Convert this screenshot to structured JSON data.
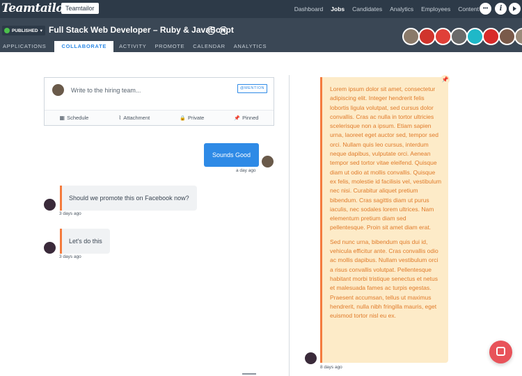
{
  "topbar": {
    "logo": "Teamtailor",
    "company": "Teamtailor",
    "nav": [
      "Dashboard",
      "Jobs",
      "Candidates",
      "Analytics",
      "Employees",
      "Content"
    ],
    "active_nav": "Jobs",
    "more_label": "•••",
    "info_label": "i"
  },
  "job": {
    "status": "PUBLISHED",
    "status_color": "#4cc04c",
    "title": "Full Stack Web Developer – Ruby & JavaScript",
    "tabs": [
      "APPLICATIONS",
      "COLLABORATE",
      "ACTIVITY",
      "PROMOTE",
      "CALENDAR",
      "ANALYTICS"
    ],
    "active_tab": "COLLABORATE",
    "avatar_colors": [
      "#8a7a6a",
      "#d0342c",
      "#e04038",
      "#6a6a6a",
      "#1fb8c8",
      "#d82a2a",
      "#7a5a4a",
      "#9a8a7a"
    ]
  },
  "composer": {
    "placeholder": "Write to the hiring team...",
    "mention_label": "@MENTION",
    "tools": [
      {
        "icon": "calendar-icon",
        "glyph": "▦",
        "label": "Schedule"
      },
      {
        "icon": "paperclip-icon",
        "glyph": "⌇",
        "label": "Attachment"
      },
      {
        "icon": "lock-icon",
        "glyph": "🔒",
        "label": "Private"
      },
      {
        "icon": "pin-icon",
        "glyph": "📌",
        "label": "Pinned"
      }
    ]
  },
  "messages": {
    "own": {
      "text": "Sounds Good",
      "time": "a day ago"
    },
    "others": [
      {
        "text": "Should we promote this on Facebook now?",
        "time": "3 days ago"
      },
      {
        "text": "Let's do this",
        "time": "3 days ago"
      }
    ]
  },
  "pinned": {
    "paragraphs": [
      "Lorem ipsum dolor sit amet, consectetur adipiscing elit. Integer hendrerit felis lobortis ligula volutpat, sed cursus dolor convallis. Cras ac nulla in tortor ultricies scelerisque non a ipsum. Etiam sapien urna, laoreet eget auctor sed, tempor sed orci. Nullam quis leo cursus, interdum neque dapibus, vulputate orci. Aenean tempor sed tortor vitae eleifend. Quisque diam ut odio at mollis convallis. Quisque ex felis, molestie id facilisis vel, vestibulum nec nisi. Curabitur aliquet pretium bibendum. Cras sagittis diam ut purus iaculis, nec sodales lorem ultrices. Nam elementum pretium diam sed pellentesque. Proin sit amet diam erat.",
      "Sed nunc urna, bibendum quis dui id, vehicula efficitur ante. Cras convallis odio ac mollis dapibus. Nullam vestibulum orci a risus convallis volutpat. Pellentesque habitant morbi tristique senectus et netus et malesuada fames ac turpis egestas. Praesent accumsan, tellus ut maximus hendrerit, nulla nibh fringilla mauris, eget euismod tortor nisl eu ex."
    ],
    "time": "8 days ago"
  },
  "colors": {
    "accent": "#2e8ae6",
    "highlight": "#f47b3d",
    "note_bg": "#fdebc8",
    "note_text": "#e07b2a"
  }
}
